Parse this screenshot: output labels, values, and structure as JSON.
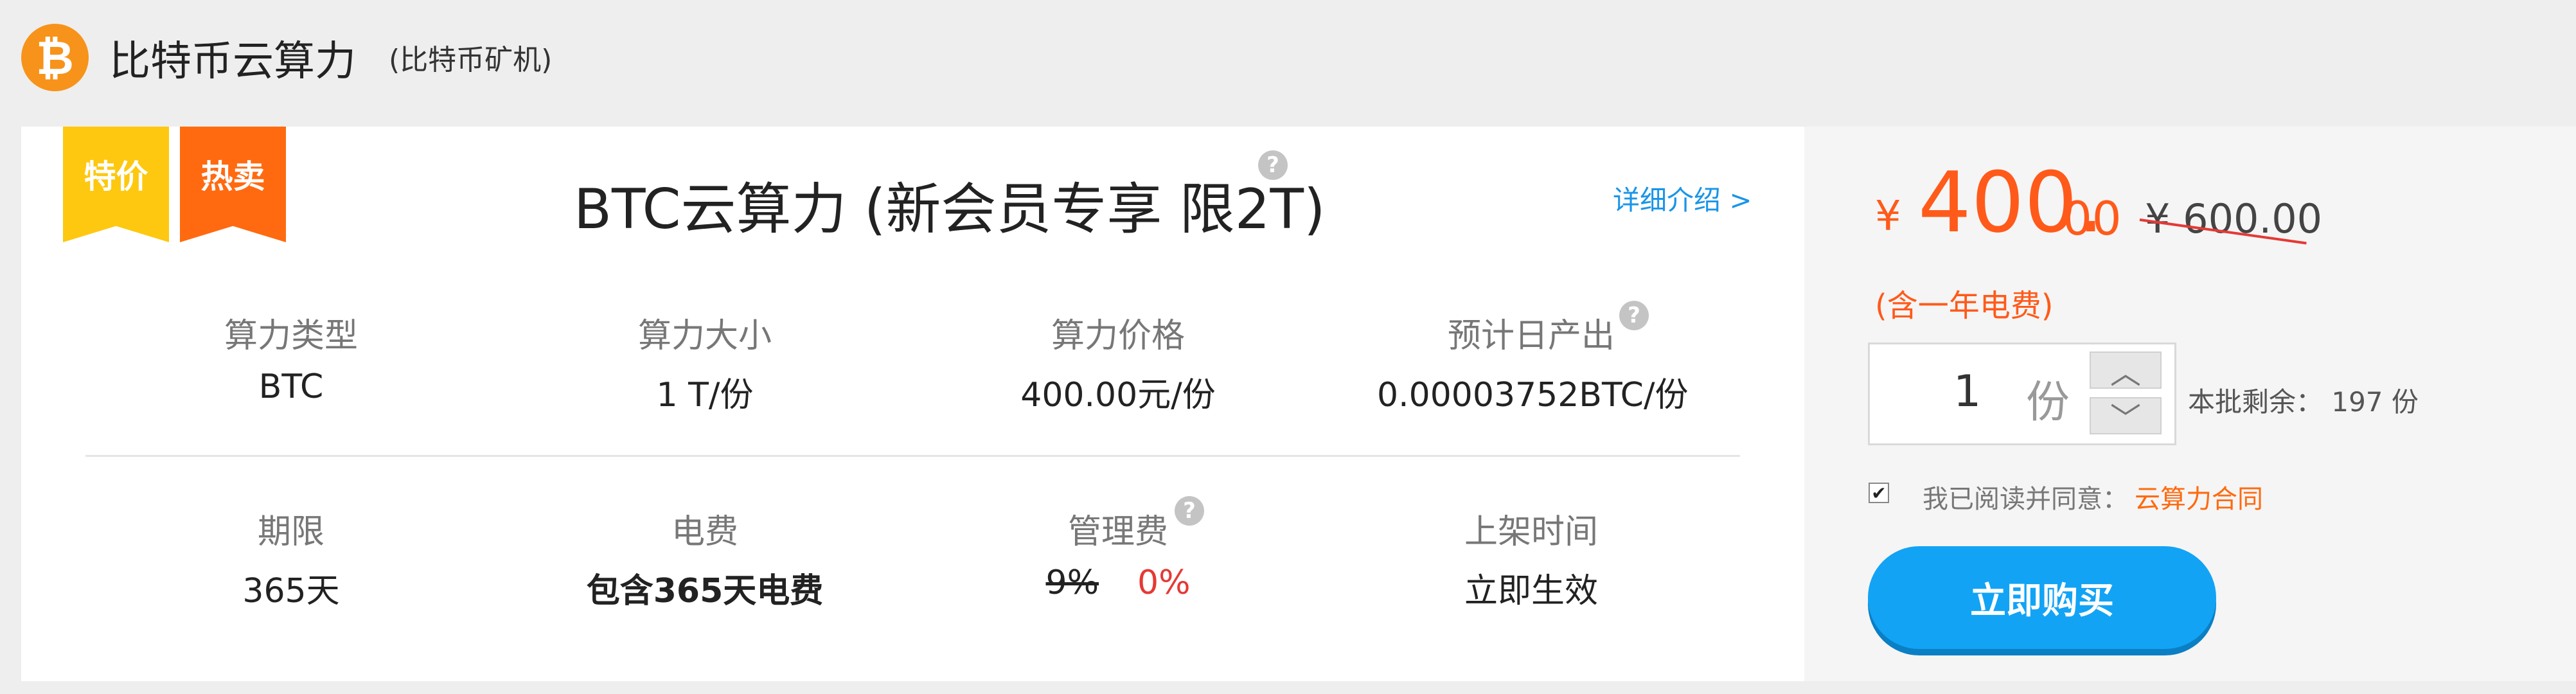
{
  "header": {
    "logo_glyph": "₿",
    "title": "比特币云算力",
    "subtitle": "(比特币矿机)"
  },
  "ribbons": {
    "sale": "特价",
    "hot": "热卖"
  },
  "product": {
    "title": "BTC云算力 (新会员专享 限2T)",
    "help_glyph": "?",
    "details_link": "详细介绍 >"
  },
  "specs_row1": [
    {
      "label": "算力类型",
      "value": "BTC"
    },
    {
      "label": "算力大小",
      "value": "1 T/份"
    },
    {
      "label": "算力价格",
      "value": "400.00元/份"
    },
    {
      "label": "预计日产出",
      "value": "0.00003752BTC/份"
    }
  ],
  "specs_row2": [
    {
      "label": "期限",
      "value": "365天"
    },
    {
      "label": "电费",
      "value": "包含365天电费"
    },
    {
      "label": "管理费",
      "old_value": "9%",
      "value": "0%"
    },
    {
      "label": "上架时间",
      "value": "立即生效"
    }
  ],
  "price": {
    "symbol": "¥",
    "integer": "400.",
    "decimal": "00",
    "old_price": "¥ 600.00",
    "note": "(含一年电费)"
  },
  "quantity": {
    "value": "1",
    "unit": "份",
    "up_glyph": "︿",
    "down_glyph": "﹀",
    "remaining": "本批剩余： 197 份"
  },
  "agreement": {
    "checked": true,
    "check_glyph": "✔",
    "text": "我已阅读并同意：",
    "link": "云算力合同"
  },
  "buy_button": "立即购买",
  "colors": {
    "accent_orange": "#ff5a1a",
    "link_blue": "#1a95e8",
    "button_blue": "#12a3f5",
    "ribbon_yellow": "#fdc80f",
    "ribbon_orange": "#ff6a10",
    "btc_orange": "#f7931a"
  }
}
